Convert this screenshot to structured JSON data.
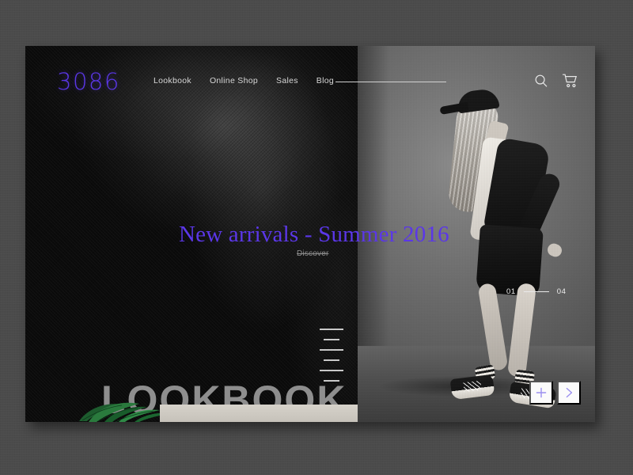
{
  "window": {
    "backdrop_color": "#4b4b4b",
    "panel_background": "#111111"
  },
  "brand": {
    "logo_text": "3086",
    "logo_color": "#5b37e8"
  },
  "nav": {
    "items": [
      {
        "label": "Lookbook"
      },
      {
        "label": "Online Shop"
      },
      {
        "label": "Sales"
      },
      {
        "label": "Blog"
      }
    ]
  },
  "tools": {
    "search_icon": "search-icon",
    "cart_icon": "shopping-cart-icon"
  },
  "hero": {
    "headline": "New arrivals - Summer 2016",
    "headline_color": "#5b37e8",
    "cta_label": "Discover",
    "cta_style": "strikethrough",
    "wordmark": "LOOKBOOK",
    "wordmark_color": "#8e8e8e"
  },
  "slider": {
    "current": "01",
    "total": "04",
    "separator": "",
    "tick_count": 6,
    "prev_label": "+",
    "next_label": ">",
    "control_icon_color": "#9b8ff0"
  }
}
